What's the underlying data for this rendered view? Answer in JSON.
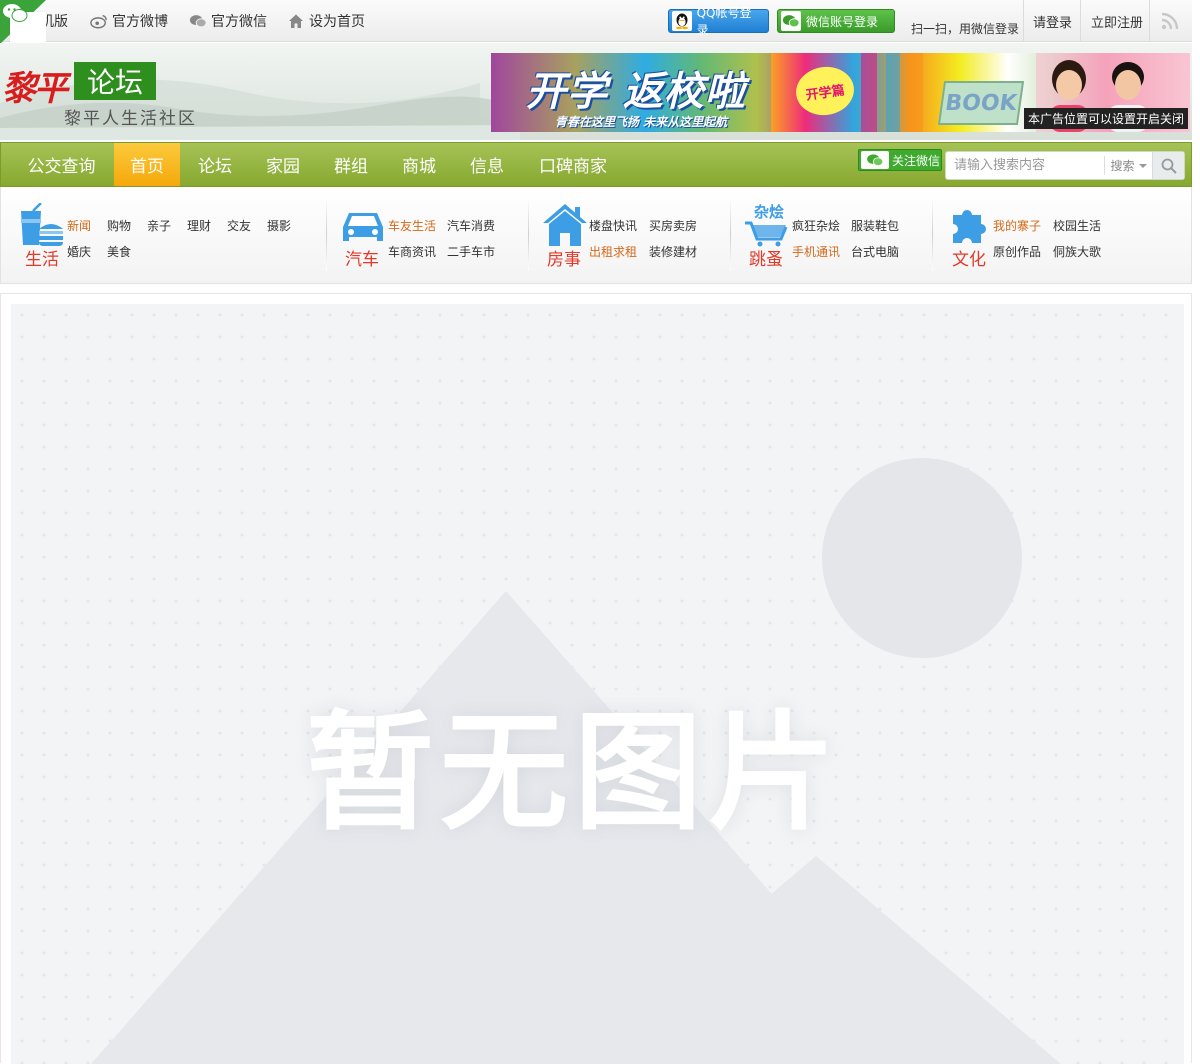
{
  "topbar": {
    "mobile_label": "机版",
    "weibo_label": "官方微博",
    "wechat_label": "官方微信",
    "homepage_label": "设为首页",
    "qq_login_label": "QQ帐号登录",
    "wechat_login_label": "微信账号登录",
    "scan_text": "扫一扫，用微信登录",
    "login_label": "请登录",
    "register_label": "立即注册"
  },
  "header": {
    "logo_red": "黎平",
    "logo_box": "论坛",
    "logo_sub": "黎平人生活社区",
    "banner": {
      "title": "开学 返校啦",
      "slogan": "青春在这里飞扬  未来从这里起航",
      "badge": "开学篇",
      "book": "BOOK",
      "close_notice": "本广告位置可以设置开启关闭"
    }
  },
  "nav": {
    "items": [
      {
        "label": "公交查询"
      },
      {
        "label": "首页",
        "active": true
      },
      {
        "label": "论坛"
      },
      {
        "label": "家园"
      },
      {
        "label": "群组"
      },
      {
        "label": "商城"
      },
      {
        "label": "信息"
      },
      {
        "label": "口碑商家"
      }
    ],
    "follow_wechat_label": "关注微信",
    "search_placeholder": "请输入搜索内容",
    "search_type": "搜索"
  },
  "categories": [
    {
      "title": "生活",
      "links": [
        "新闻",
        "购物",
        "亲子",
        "理财",
        "交友",
        "摄影",
        "婚庆",
        "美食"
      ]
    },
    {
      "title": "汽车",
      "links": [
        "车友生活",
        "汽车消费",
        "车商资讯",
        "二手车市"
      ]
    },
    {
      "title": "房事",
      "links": [
        "楼盘快讯",
        "买房卖房",
        "出租求租",
        "装修建材"
      ]
    },
    {
      "title": "跳蚤",
      "icon_label": "杂烩",
      "links": [
        "疯狂杂烩",
        "服装鞋包",
        "手机通讯",
        "台式电脑"
      ]
    },
    {
      "title": "文化",
      "links": [
        "我的寨子",
        "校园生活",
        "原创作品",
        "侗族大歌"
      ]
    }
  ],
  "content": {
    "placeholder_text": "暂无图片"
  },
  "colors": {
    "nav_green": "#9ab846",
    "nav_active": "#f8b41e",
    "logo_red": "#d81d1d",
    "logo_green": "#2e8e1e",
    "category_title": "#e23a2a",
    "link_hot": "#d4691a",
    "icon_blue": "#3d9ee6"
  },
  "icons": {
    "corner": "wechat-icon",
    "weibo": "weibo-icon",
    "wechat": "wechat-icon",
    "homepage": "home-icon",
    "qq": "qq-penguin-icon",
    "rss": "rss-icon",
    "search": "magnifier-icon",
    "life": "drink-burger-icon",
    "car": "car-icon",
    "house": "house-icon",
    "flea": "shopping-cart-icon",
    "culture": "puzzle-icon"
  }
}
